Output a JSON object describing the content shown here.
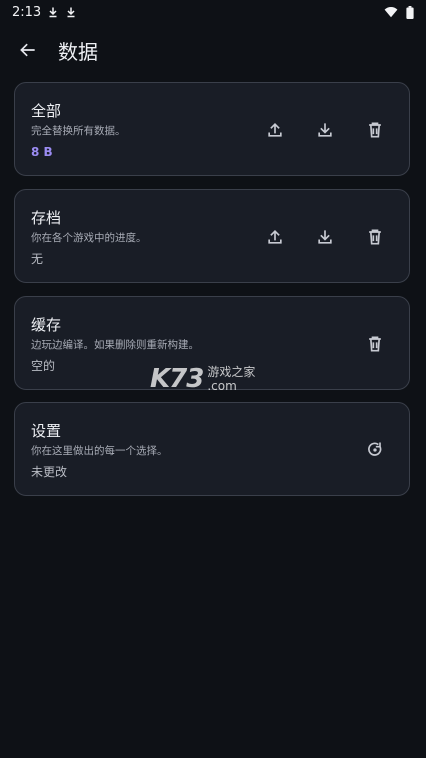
{
  "status": {
    "time": "2:13"
  },
  "header": {
    "title": "数据"
  },
  "cards": [
    {
      "title": "全部",
      "desc": "完全替换所有数据。",
      "value": "8 B"
    },
    {
      "title": "存档",
      "desc": "你在各个游戏中的进度。",
      "value": "无"
    },
    {
      "title": "缓存",
      "desc": "边玩边编译。如果删除则重新构建。",
      "value": "空的"
    },
    {
      "title": "设置",
      "desc": "你在这里做出的每一个选择。",
      "value": "未更改"
    }
  ],
  "watermark": {
    "brand": "K73",
    "name": "游戏之家",
    "domain": ".com"
  },
  "icons": {
    "upload": "upload-icon",
    "download": "download-icon",
    "delete": "trash-icon",
    "reset": "reset-icon",
    "back": "arrow-left-icon"
  },
  "colors": {
    "background": "#0e1116",
    "card": "#191d26",
    "accent": "#9b8cf2"
  }
}
